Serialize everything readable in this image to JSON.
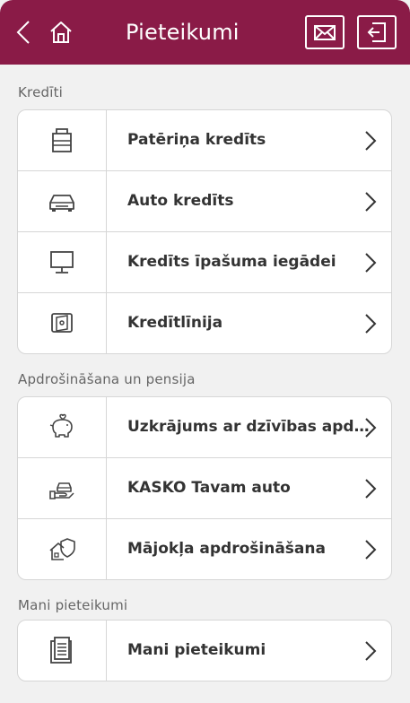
{
  "header": {
    "title": "Pieteikumi",
    "background": "#8a1b47",
    "back_icon": "chevron-left-icon",
    "home_icon": "home-icon",
    "mail_icon": "envelope-icon",
    "logout_icon": "logout-icon"
  },
  "sections": [
    {
      "label": "Kredīti",
      "items": [
        {
          "label": "Patēriņa kredīts",
          "icon": "shopping-bag-icon"
        },
        {
          "label": "Auto kredīts",
          "icon": "car-icon"
        },
        {
          "label": "Kredīts īpašuma iegādei",
          "icon": "monitor-icon"
        },
        {
          "label": "Kredītlīnija",
          "icon": "wallet-icon"
        }
      ]
    },
    {
      "label": "Apdrošināšana un pensija",
      "items": [
        {
          "label": "Uzkrājums ar dzīvības apdrošināšanu",
          "icon": "piggy-bank-icon"
        },
        {
          "label": "KASKO Tavam auto",
          "icon": "car-in-hand-icon"
        },
        {
          "label": "Mājokļa apdrošināšana",
          "icon": "house-shield-icon"
        }
      ]
    },
    {
      "label": "Mani pieteikumi",
      "items": [
        {
          "label": "Mani pieteikumi",
          "icon": "documents-icon"
        }
      ]
    }
  ],
  "colors": {
    "accent": "#8a1b47",
    "background": "#f1f1f1",
    "card_border": "#d6d6d6",
    "text": "#333333"
  }
}
